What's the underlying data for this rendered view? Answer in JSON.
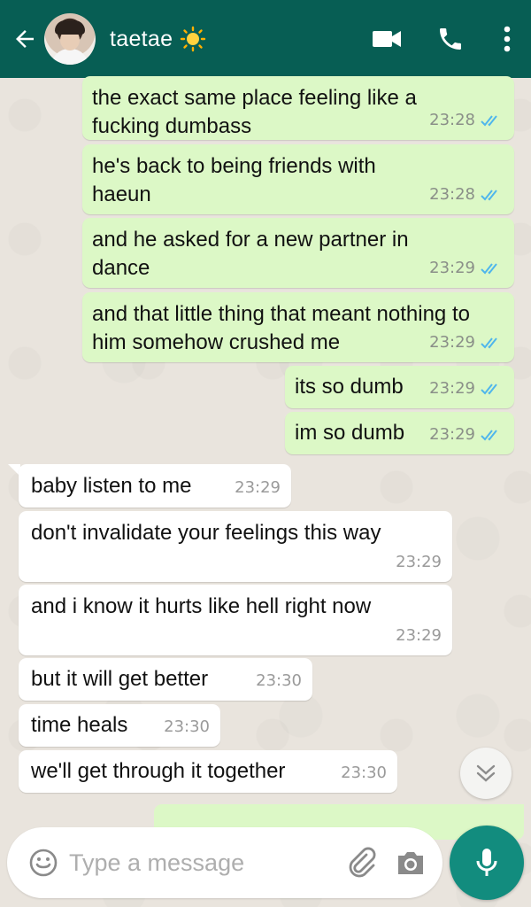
{
  "header": {
    "contact_name": "taetae",
    "status_emoji": "sun-emoji"
  },
  "messages": [
    {
      "direction": "out",
      "text": "the exact same place feeling like a fucking dumbass",
      "time": "23:28"
    },
    {
      "direction": "out",
      "text": "he's back to being friends with haeun",
      "time": "23:28"
    },
    {
      "direction": "out",
      "text": "and he asked for a new partner in dance",
      "time": "23:29"
    },
    {
      "direction": "out",
      "text": "and that little thing that meant nothing to him somehow crushed me",
      "time": "23:29"
    },
    {
      "direction": "out",
      "text": "its so dumb",
      "time": "23:29"
    },
    {
      "direction": "out",
      "text": "im so dumb",
      "time": "23:29"
    },
    {
      "direction": "in",
      "text": "baby listen to me",
      "time": "23:29"
    },
    {
      "direction": "in",
      "text": "don't invalidate your feelings this way",
      "time": "23:29"
    },
    {
      "direction": "in",
      "text": "and i know it hurts like hell right now",
      "time": "23:29"
    },
    {
      "direction": "in",
      "text": "but it will get better",
      "time": "23:30"
    },
    {
      "direction": "in",
      "text": "time heals",
      "time": "23:30"
    },
    {
      "direction": "in",
      "text": "we'll get through it together",
      "time": "23:30"
    }
  ],
  "input": {
    "placeholder": "Type a message"
  },
  "colors": {
    "header": "#075e54",
    "outgoing_bubble": "#dcf8c6",
    "incoming_bubble": "#ffffff",
    "read_ticks": "#4fb6ec",
    "mic_button": "#128c7e"
  }
}
